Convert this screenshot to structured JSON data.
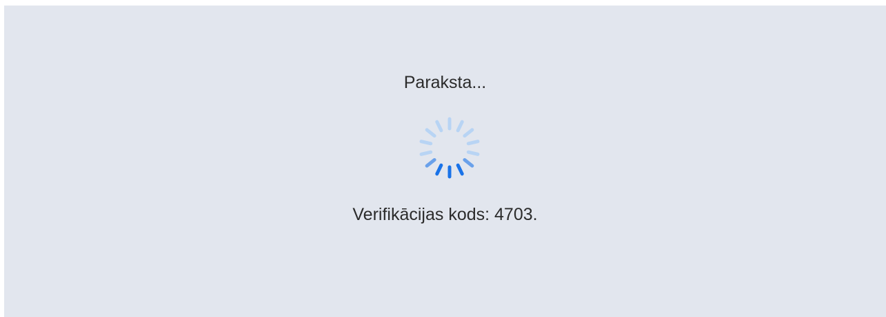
{
  "status": {
    "label": "Paraksta..."
  },
  "spinner": {
    "icon": "loading-spinner-icon",
    "active_color": "#1a73e8",
    "inactive_color": "#a9cdf5"
  },
  "verification": {
    "prefix": "Verifikācijas kods: ",
    "code": "4703",
    "suffix": "."
  },
  "colors": {
    "background": "#e2e6ee",
    "text": "#2b2b2b"
  }
}
